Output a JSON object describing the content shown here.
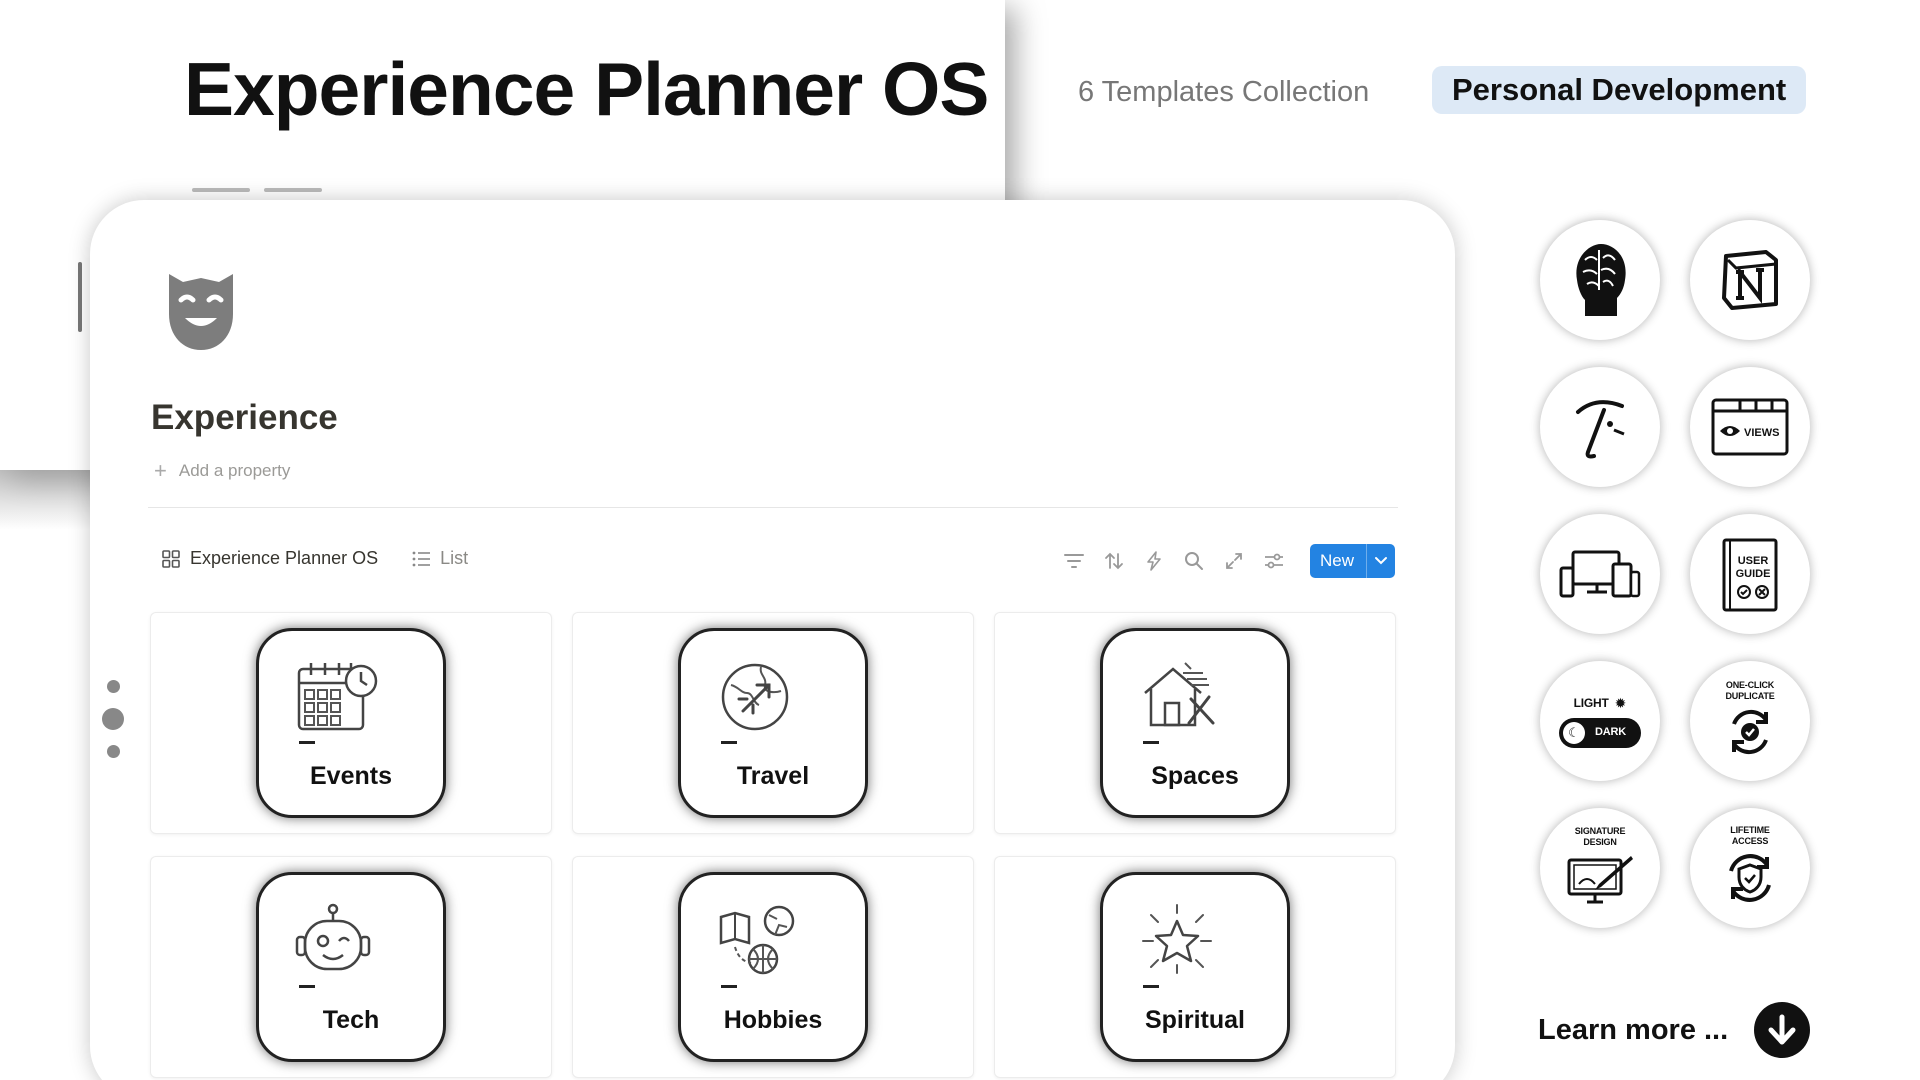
{
  "header": {
    "title": "Experience Planner OS",
    "subtitle": "6 Templates Collection",
    "category": "Personal Development"
  },
  "page": {
    "icon": "theater-mask-icon",
    "title": "Experience",
    "add_property": "Add a property"
  },
  "views": [
    {
      "label": "Experience Planner OS",
      "icon": "gallery-icon",
      "active": true
    },
    {
      "label": "List",
      "icon": "list-icon",
      "active": false
    }
  ],
  "toolbar": {
    "icons": [
      "filter-icon",
      "sort-icon",
      "lightning-icon",
      "search-icon",
      "expand-icon",
      "settings-sliders-icon"
    ],
    "new_label": "New"
  },
  "cards": [
    {
      "label": "Events",
      "icon": "calendar-clock-icon"
    },
    {
      "label": "Travel",
      "icon": "globe-plane-icon"
    },
    {
      "label": "Spaces",
      "icon": "house-tools-icon"
    },
    {
      "label": "Tech",
      "icon": "robot-icon"
    },
    {
      "label": "Hobbies",
      "icon": "hobbies-icon"
    },
    {
      "label": "Spiritual",
      "icon": "sparkle-star-icon"
    }
  ],
  "badges": {
    "light": "LIGHT",
    "dark": "DARK",
    "views": "VIEWS",
    "user_guide": "USER GUIDE",
    "one_click": "ONE-CLICK DUPLICATE",
    "signature": "SIGNATURE DESIGN",
    "lifetime": "LIFETIME ACCESS"
  },
  "learn_more": "Learn more ...",
  "colors": {
    "accent": "#2383e2",
    "pill": "#dde9f6",
    "text": "#111111"
  }
}
